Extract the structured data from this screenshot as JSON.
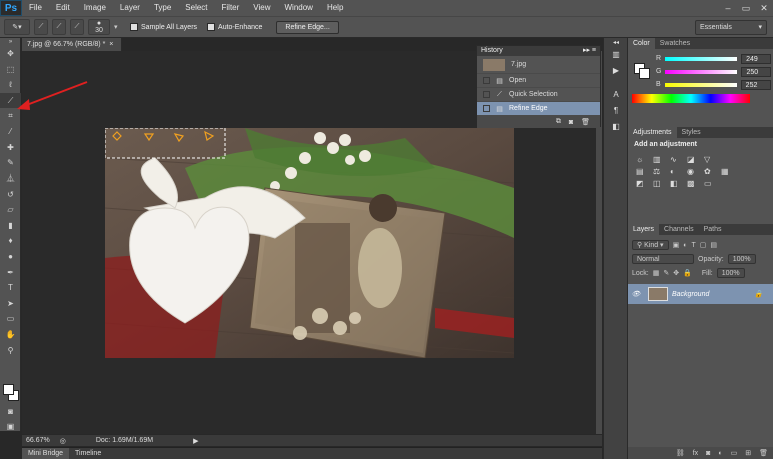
{
  "app": {
    "logo": "Ps"
  },
  "menu": [
    "File",
    "Edit",
    "Image",
    "Layer",
    "Type",
    "Select",
    "Filter",
    "View",
    "Window",
    "Help"
  ],
  "window_controls": [
    "–",
    "▭",
    "✕"
  ],
  "options_bar": {
    "brush_size": "30",
    "sample_all_layers": "Sample All Layers",
    "auto_enhance": "Auto-Enhance",
    "refine_edge": "Refine Edge...",
    "workspace": "Essentials"
  },
  "document": {
    "tab_title": "7.jpg @ 66.7% (RGB/8) *",
    "tab_close": "×",
    "zoom": "66.67%",
    "doc_info": "Doc: 1.69M/1.69M"
  },
  "bottom_tabs": [
    "Mini Bridge",
    "Timeline"
  ],
  "history": {
    "title": "History",
    "snapshot": "7.jpg",
    "items": [
      {
        "label": "Open",
        "icon": "document-icon"
      },
      {
        "label": "Quick Selection",
        "icon": "quick-selection-icon"
      },
      {
        "label": "Refine Edge",
        "icon": "document-icon"
      }
    ],
    "selected_index": 2
  },
  "color_panel": {
    "tabs": [
      "Color",
      "Swatches"
    ],
    "r_label": "R",
    "r_value": "249",
    "g_label": "G",
    "g_value": "250",
    "b_label": "B",
    "b_value": "252"
  },
  "adjustments": {
    "tabs": [
      "Adjustments",
      "Styles"
    ],
    "heading": "Add an adjustment"
  },
  "layers": {
    "tabs": [
      "Layers",
      "Channels",
      "Paths"
    ],
    "filter_kind": "Kind",
    "blend_mode": "Normal",
    "opacity_label": "Opacity:",
    "opacity_value": "100%",
    "lock_label": "Lock:",
    "fill_label": "Fill:",
    "fill_value": "100%",
    "layer_name": "Background"
  },
  "colors": {
    "accent": "#7d93b0",
    "annotation_arrow": "#e02020",
    "ps_blue": "#31a8ff"
  }
}
